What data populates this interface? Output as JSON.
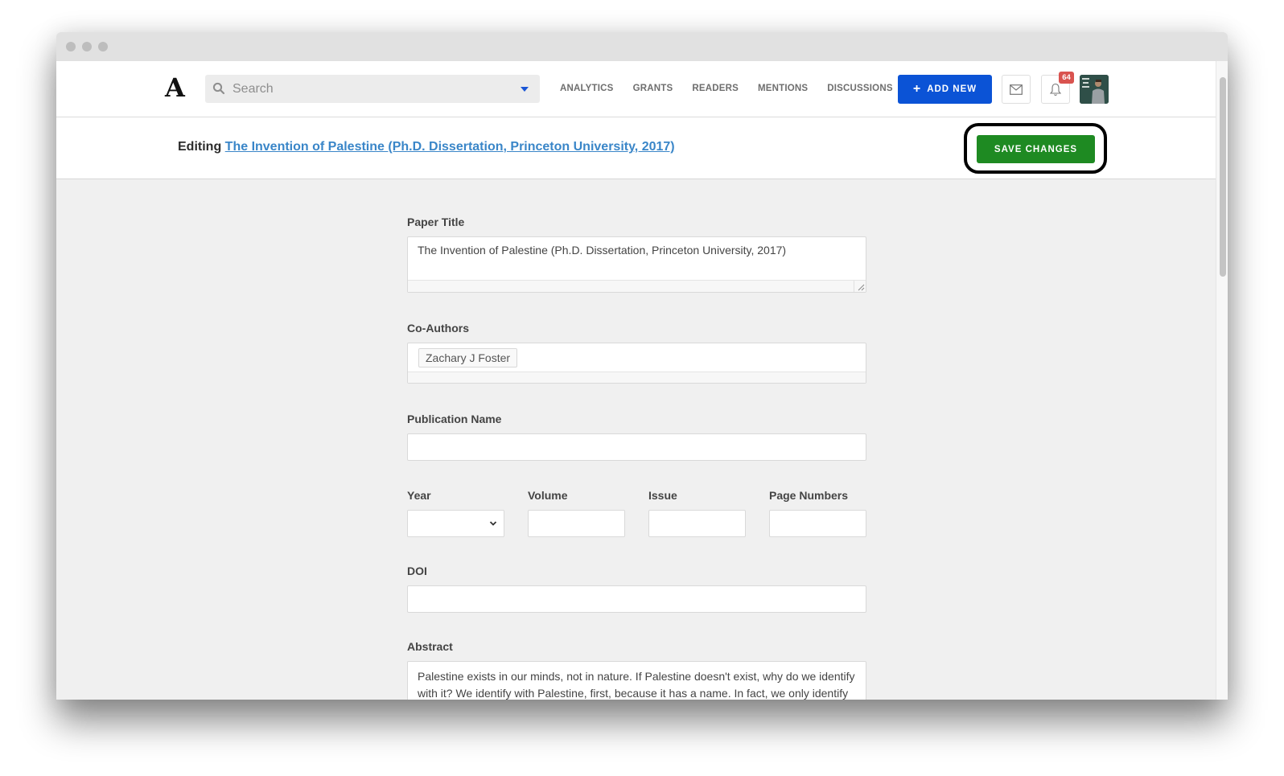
{
  "header": {
    "logo": "A",
    "search_placeholder": "Search",
    "nav": [
      "ANALYTICS",
      "GRANTS",
      "READERS",
      "MENTIONS",
      "DISCUSSIONS"
    ],
    "add_new_label": "ADD NEW",
    "add_new_icon": "+",
    "notification_count": "64",
    "colors": {
      "primary": "#0b53d6",
      "badge": "#d9534f"
    }
  },
  "edit_bar": {
    "prefix": "Editing",
    "paper_link": "The Invention of Palestine (Ph.D. Dissertation, Princeton University, 2017)",
    "save_label": "SAVE CHANGES",
    "colors": {
      "save": "#1e8a22",
      "link": "#3a86c8"
    }
  },
  "form": {
    "paper_title": {
      "label": "Paper Title",
      "value": "The Invention of Palestine (Ph.D. Dissertation, Princeton University, 2017)"
    },
    "co_authors": {
      "label": "Co-Authors",
      "tags": [
        "Zachary J Foster"
      ]
    },
    "publication_name": {
      "label": "Publication Name",
      "value": ""
    },
    "year": {
      "label": "Year",
      "value": ""
    },
    "volume": {
      "label": "Volume",
      "value": ""
    },
    "issue": {
      "label": "Issue",
      "value": ""
    },
    "page_numbers": {
      "label": "Page Numbers",
      "value": ""
    },
    "doi": {
      "label": "DOI",
      "value": ""
    },
    "abstract": {
      "label": "Abstract",
      "value": "Palestine exists in our minds, not in nature. If Palestine doesn't exist, why do we identify with it? We identify with Palestine, first, because it has a name. In fact, we only identify"
    }
  }
}
